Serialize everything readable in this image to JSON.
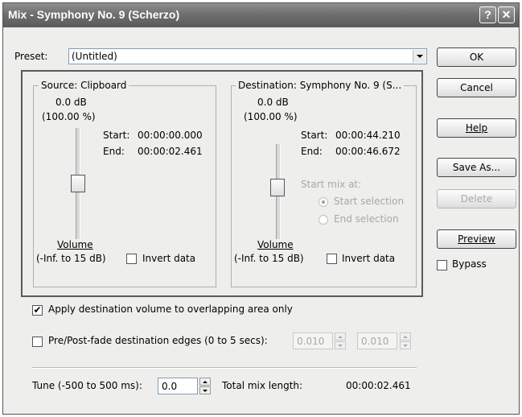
{
  "window": {
    "title": "Mix - Symphony No. 9 (Scherzo)",
    "help_glyph": "?",
    "close_glyph": "✕"
  },
  "preset": {
    "label": "Preset:",
    "value": "(Untitled)"
  },
  "buttons": {
    "ok": "OK",
    "cancel": "Cancel",
    "help": "Help",
    "save_as": "Save As...",
    "delete": "Delete",
    "preview": "Preview"
  },
  "bypass": {
    "label": "Bypass",
    "checked": false
  },
  "source": {
    "legend": "Source: Clipboard",
    "db": "0.0 dB",
    "percent": "(100.00 %)",
    "start_label": "Start:",
    "start_value": "00:00:00.000",
    "end_label": "End:",
    "end_value": "00:00:02.461",
    "volume_label": "Volume",
    "volume_range": "(-Inf. to 15 dB)",
    "invert_label": "Invert data",
    "invert_checked": false,
    "volume_level": 0.5
  },
  "destination": {
    "legend": "Destination: Symphony No. 9 (S...",
    "db": "0.0 dB",
    "percent": "(100.00 %)",
    "start_label": "Start:",
    "start_value": "00:00:44.210",
    "end_label": "End:",
    "end_value": "00:00:46.672",
    "start_mix_label": "Start mix at:",
    "option_start": "Start selection",
    "option_end": "End selection",
    "selected_option": "Start selection",
    "volume_label": "Volume",
    "volume_range": "(-Inf. to 15 dB)",
    "invert_label": "Invert data",
    "invert_checked": false,
    "volume_level": 0.5
  },
  "apply_dest_volume": {
    "label": "Apply destination volume to overlapping area only",
    "checked": true
  },
  "fade": {
    "label": "Pre/Post-fade destination edges (0 to 5 secs):",
    "checked": false,
    "pre_value": "0.010",
    "post_value": "0.010"
  },
  "tune": {
    "label": "Tune (-500 to 500 ms):",
    "value": "0.0"
  },
  "total_mix": {
    "label": "Total mix length:",
    "value": "00:00:02.461"
  },
  "icons": {
    "check_mark": "✔"
  }
}
